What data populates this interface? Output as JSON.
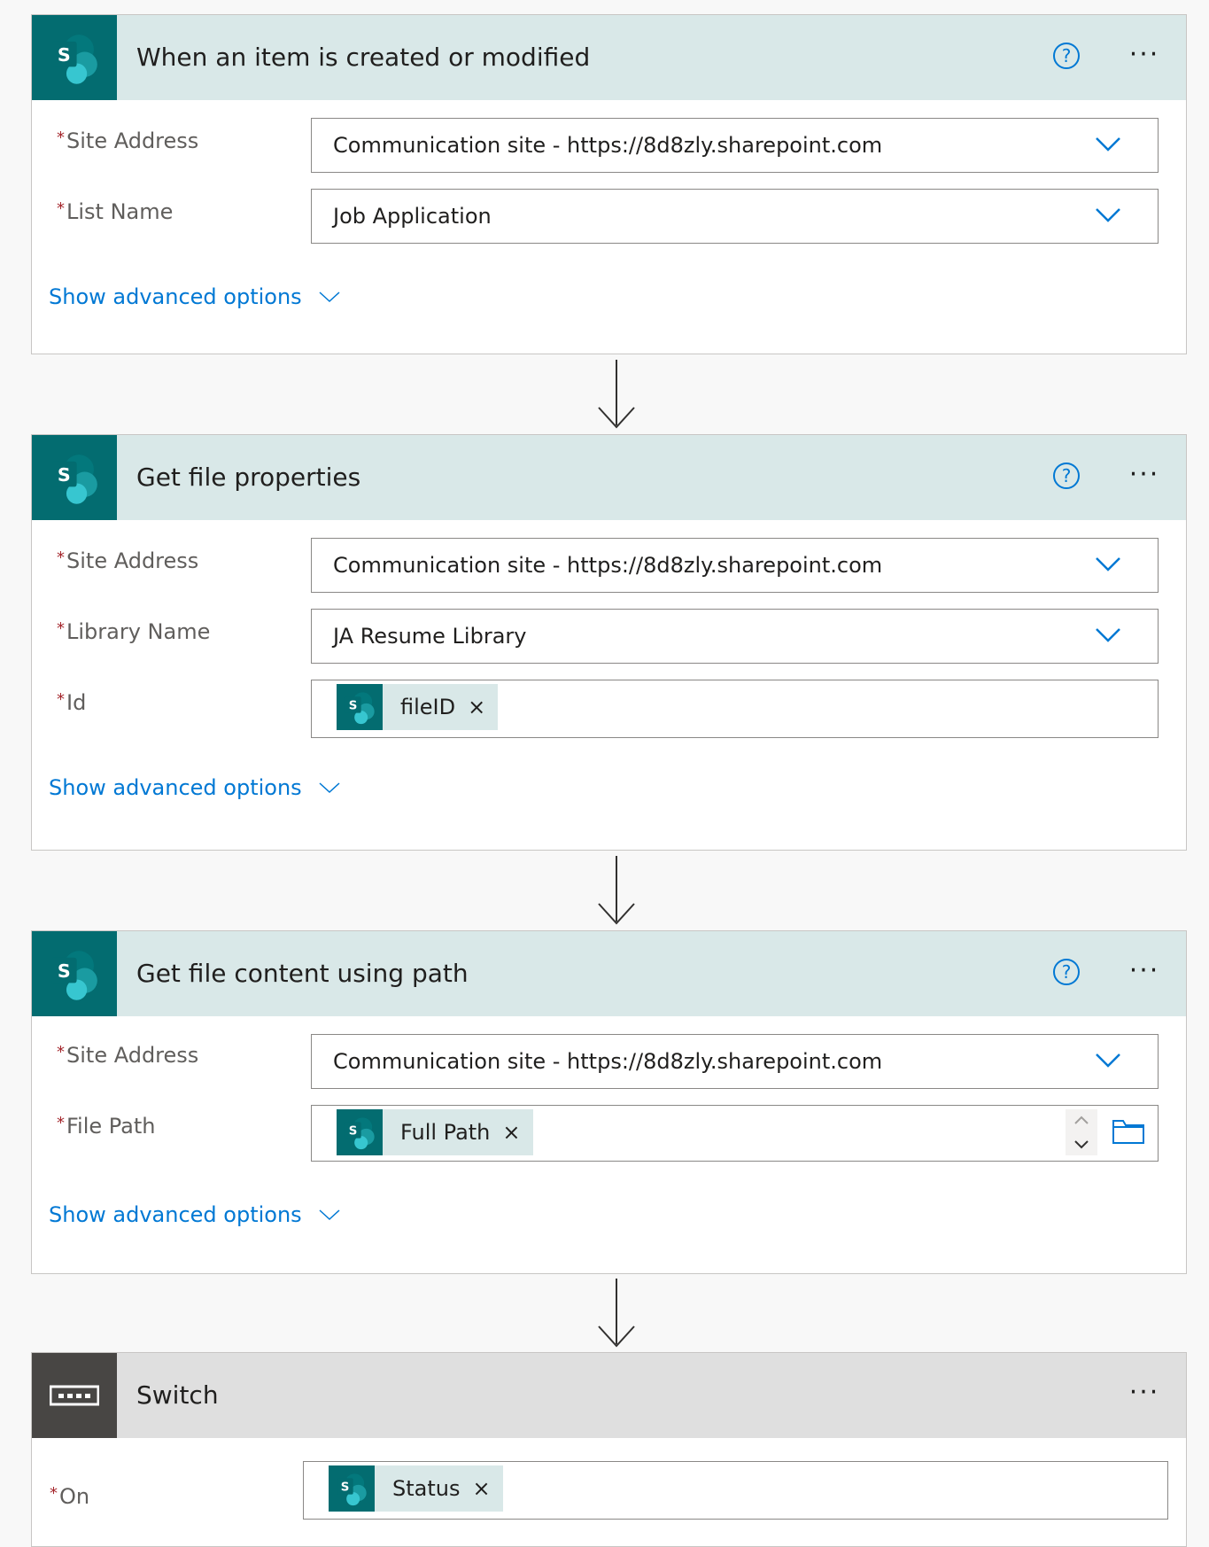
{
  "steps": [
    {
      "title": "When an item is created or modified",
      "fields": [
        {
          "label": "Site Address",
          "value": "Communication site - https://8d8zly.sharepoint.com"
        },
        {
          "label": "List Name",
          "value": "Job Application"
        }
      ],
      "advanced": "Show advanced options"
    },
    {
      "title": "Get file properties",
      "fields": [
        {
          "label": "Site Address",
          "value": "Communication site - https://8d8zly.sharepoint.com"
        },
        {
          "label": "Library Name",
          "value": "JA Resume Library"
        },
        {
          "label": "Id",
          "token": "fileID"
        }
      ],
      "advanced": "Show advanced options"
    },
    {
      "title": "Get file content using path",
      "fields": [
        {
          "label": "Site Address",
          "value": "Communication site - https://8d8zly.sharepoint.com"
        },
        {
          "label": "File Path",
          "token": "Full Path"
        }
      ],
      "advanced": "Show advanced options"
    },
    {
      "title": "Switch",
      "fields": [
        {
          "label": "On",
          "token": "Status"
        }
      ]
    }
  ],
  "common": {
    "required_mark": "*",
    "help_glyph": "?",
    "more_glyph": "···",
    "remove_glyph": "×",
    "sharepoint_icon": "sharepoint-icon",
    "switch_icon": "switch-icon"
  },
  "colors": {
    "sharepoint": "#036c70",
    "header_bg": "#d9e8e8",
    "switch_header_bg": "#dfdfdf",
    "link": "#0078d4",
    "required": "#a4262c"
  }
}
